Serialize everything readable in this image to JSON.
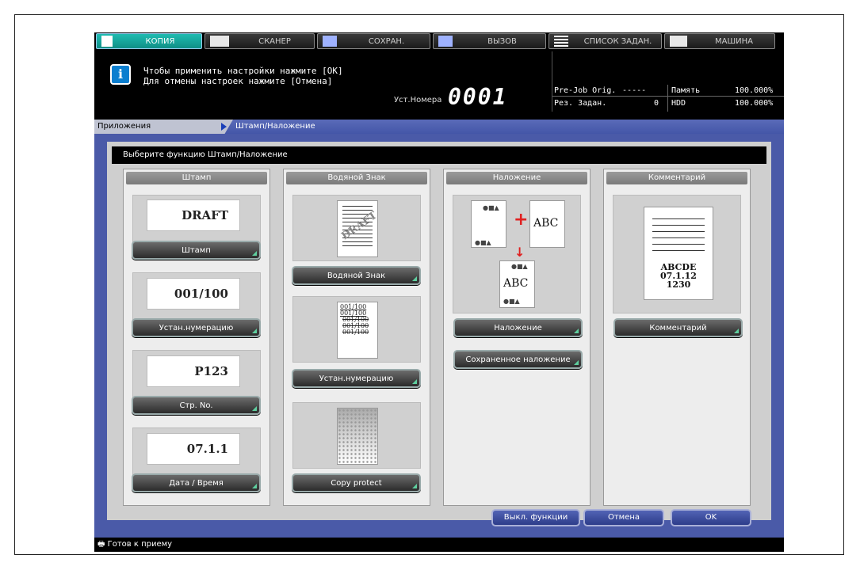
{
  "tabs": [
    {
      "label": "КОПИЯ",
      "active": true
    },
    {
      "label": "СКАНЕР",
      "active": false
    },
    {
      "label": "СОХРАН.",
      "active": false
    },
    {
      "label": "ВЫЗОВ",
      "active": false
    },
    {
      "label": "СПИСОК ЗАДАН.",
      "active": false
    },
    {
      "label": "МАШИНА",
      "active": false
    }
  ],
  "message": {
    "line1": "Чтобы применить настройки нажмите [OK]",
    "line2": "Для отмены настроек нажмите [Отмена]"
  },
  "set_number": {
    "label": "Уст.Номера",
    "value": "0001"
  },
  "status": {
    "prejob_label": "Pre-Job Orig.",
    "prejob_value": "-----",
    "memory_label": "Память",
    "memory_value": "100.000%",
    "reserved_label": "Рез. Задан.",
    "reserved_value": "0",
    "hdd_label": "HDD",
    "hdd_value": "100.000%"
  },
  "breadcrumb": {
    "parent": "Приложения",
    "current": "Штамп/Наложение"
  },
  "prompt": "Выберите функцию Штамп/Наложение",
  "columns": {
    "stamp": {
      "header": "Штамп",
      "samples": [
        "DRAFT",
        "001/100",
        "P123",
        "07.1.1"
      ],
      "buttons": [
        "Штамп",
        "Устан.нумерацию",
        "Стр. No.",
        "Дата / Время"
      ]
    },
    "watermark": {
      "header": "Водяной Знак",
      "sample_text": "DRAFT",
      "numbering_lines": [
        "001/100",
        "001/100",
        "001/100",
        "001/100",
        "001/100"
      ],
      "buttons": [
        "Водяной Знак",
        "Устан.нумерацию",
        "Copy protect"
      ]
    },
    "overlay": {
      "header": "Наложение",
      "sample_text": "ABC",
      "buttons": [
        "Наложение",
        "Сохраненное наложение"
      ]
    },
    "comment": {
      "header": "Комментарий",
      "sample_lines": [
        "ABCDE",
        "07.1.12",
        "1230"
      ],
      "buttons": [
        "Комментарий"
      ]
    }
  },
  "bottom": {
    "off_label": "Выкл. функции",
    "cancel_label": "Отмена",
    "ok_label": "OK"
  },
  "statusbar": "Готов к приему",
  "colors": {
    "accent_tab": "#1fbcb1",
    "panel_blue": "#4a5aa8",
    "overlay_red": "#e02020"
  }
}
